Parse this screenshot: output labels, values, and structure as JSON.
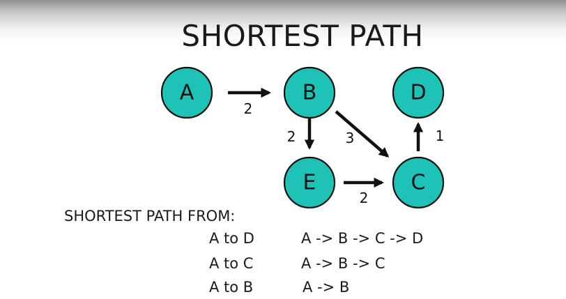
{
  "title": "SHORTEST PATH",
  "nodes": [
    {
      "id": "A",
      "label": "A"
    },
    {
      "id": "B",
      "label": "B"
    },
    {
      "id": "D",
      "label": "D"
    },
    {
      "id": "E",
      "label": "E"
    },
    {
      "id": "C",
      "label": "C"
    }
  ],
  "edges": [
    {
      "from": "A",
      "to": "B",
      "weight": "2"
    },
    {
      "from": "B",
      "to": "E",
      "weight": "2"
    },
    {
      "from": "B",
      "to": "C",
      "weight": "3"
    },
    {
      "from": "E",
      "to": "C",
      "weight": "2"
    },
    {
      "from": "C",
      "to": "D",
      "weight": "1"
    }
  ],
  "colors": {
    "node_fill": "#1fc2b7",
    "node_stroke": "#111111",
    "edge": "#111111"
  },
  "summary": {
    "heading": "SHORTEST PATH FROM:",
    "rows": [
      {
        "pair": "A to D",
        "route": "A -> B -> C -> D"
      },
      {
        "pair": "A to C",
        "route": "A -> B -> C"
      },
      {
        "pair": "A to B",
        "route": "A -> B"
      }
    ]
  }
}
